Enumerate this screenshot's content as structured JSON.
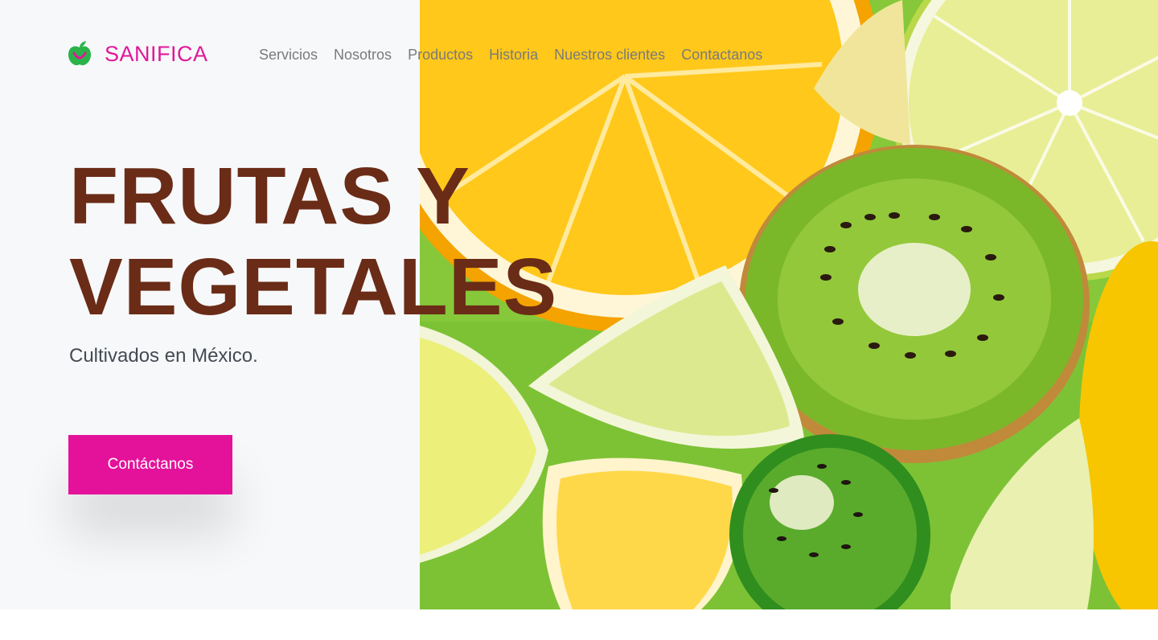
{
  "brand": {
    "name": "SANIFICA",
    "icon": "apple-leaf-icon",
    "color": "#e0189a"
  },
  "nav": {
    "items": [
      {
        "label": "Servicios"
      },
      {
        "label": "Nosotros"
      },
      {
        "label": "Productos"
      },
      {
        "label": "Historia"
      },
      {
        "label": "Nuestros clientes"
      },
      {
        "label": "Contactanos"
      }
    ]
  },
  "hero": {
    "title_line1": "FRUTAS Y",
    "title_line2": "VEGETALES",
    "subtitle": "Cultivados en México.",
    "cta_label": "Contáctanos",
    "title_color": "#6a2c17",
    "cta_color": "#e4129a",
    "image": "citrus-and-kiwi-slices"
  }
}
